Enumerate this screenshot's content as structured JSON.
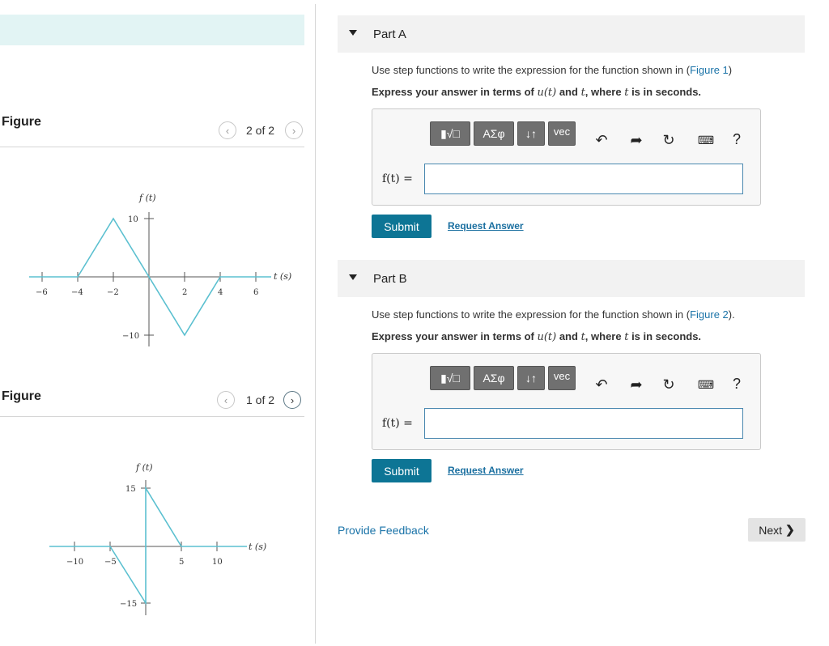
{
  "figure_panel": {
    "title": "Figure",
    "top_pager": {
      "text": "2 of 2"
    },
    "bottom_pager": {
      "text": "1 of 2"
    },
    "graph1": {
      "ylabel": "f (t)",
      "xlabel": "t (s)",
      "x_ticks": [
        "−6",
        "−4",
        "−2",
        "2",
        "4",
        "6"
      ],
      "y_ticks": [
        "10",
        "−10"
      ]
    },
    "graph2": {
      "ylabel": "f (t)",
      "xlabel": "t (s)",
      "x_ticks": [
        "−10",
        "−5",
        "5",
        "10"
      ],
      "y_ticks": [
        "15",
        "−15"
      ]
    }
  },
  "part_a": {
    "title": "Part A",
    "prompt_text": "Use step functions to write the expression for the function shown in (",
    "prompt_link": "Figure 1",
    "prompt_end": ")",
    "express_pre": "Express your answer in terms of ",
    "express_ut": "u(t)",
    "express_and": " and ",
    "express_t": "t",
    "express_where": ", where ",
    "express_t2": "t",
    "express_post": " is in seconds.",
    "f_label": "f(t) =",
    "input_value": "",
    "submit_label": "Submit",
    "request_label": "Request Answer"
  },
  "part_b": {
    "title": "Part B",
    "prompt_text": "Use step functions to write the expression for the function shown in (",
    "prompt_link": "Figure 2",
    "prompt_end": ").",
    "express_pre": "Express your answer in terms of ",
    "express_ut": "u(t)",
    "express_and": " and ",
    "express_t": "t",
    "express_where": ", where ",
    "express_t2": "t",
    "express_post": " is in seconds.",
    "f_label": "f(t) =",
    "input_value": "",
    "submit_label": "Submit",
    "request_label": "Request Answer"
  },
  "toolbar": {
    "templates_icon": "templates-icon",
    "greek_label": "ΑΣφ",
    "arrows_label": "↓↑",
    "vec_label": "vec",
    "help_label": "?"
  },
  "footer": {
    "feedback_label": "Provide Feedback",
    "next_label": "Next"
  },
  "colors": {
    "accent": "#0d7595",
    "link": "#1a73a8",
    "graph_line": "#5bc0d0",
    "topbar": "#e2f4f4"
  }
}
